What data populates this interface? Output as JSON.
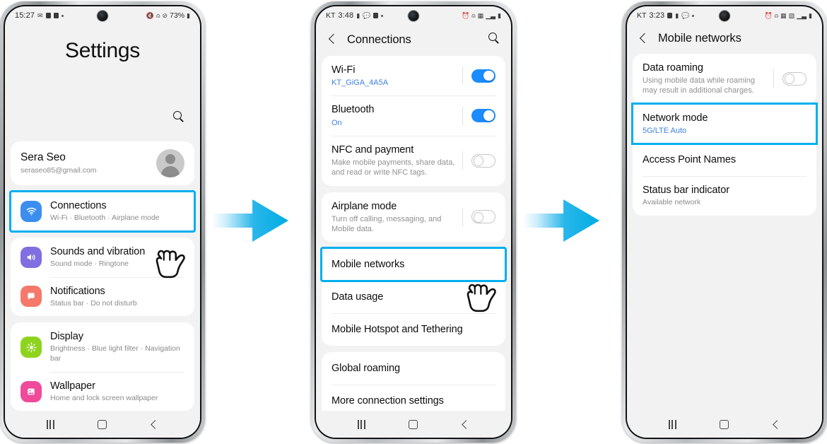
{
  "colors": {
    "accent_highlight": "#00AEEF",
    "toggle_on": "#1a8cff",
    "link_blue": "#3b7fe0",
    "screen_bg": "#f2f2f2",
    "card_bg": "#ffffff"
  },
  "phone1": {
    "status": {
      "time": "15:27",
      "icons_left": [
        "message-icon",
        "photo-icon",
        "mail-icon",
        "dot-icon"
      ],
      "icons_right": [
        "mute-icon",
        "wifi-icon",
        "do-not-disturb-icon"
      ],
      "battery_percent": "73%",
      "battery_icon": "battery-icon"
    },
    "title": "Settings",
    "search_icon": "search-icon",
    "account": {
      "name": "Sera Seo",
      "email": "seraseo85@gmail.com",
      "avatar": "avatar-icon"
    },
    "items": [
      {
        "title": "Connections",
        "subtitle": "Wi-Fi  ·  Bluetooth  ·  Airplane mode",
        "icon": "wifi-icon",
        "icon_color": "#3b8ef0",
        "highlighted": true
      },
      {
        "title": "Sounds and vibration",
        "subtitle": "Sound mode  ·  Ringtone",
        "icon": "speaker-icon",
        "icon_color": "#7f6fe0",
        "highlighted": false
      },
      {
        "title": "Notifications",
        "subtitle": "Status bar  ·  Do not disturb",
        "icon": "bell-icon",
        "icon_color": "#f4796b",
        "highlighted": false
      },
      {
        "title": "Display",
        "subtitle": "Brightness  ·  Blue light filter  ·  Navigation bar",
        "icon": "brightness-icon",
        "icon_color": "#8ed41f",
        "highlighted": false
      },
      {
        "title": "Wallpaper",
        "subtitle": "Home and lock screen wallpaper",
        "icon": "image-icon",
        "icon_color": "#ef4b9a",
        "highlighted": false
      }
    ],
    "navbar": [
      "recents-icon",
      "home-icon",
      "back-icon"
    ]
  },
  "phone2": {
    "status": {
      "carrier": "KT",
      "time": "3:48",
      "icons_left": [
        "battery-icon",
        "chat-icon",
        "video-icon",
        "dot-icon"
      ],
      "icons_right": [
        "alarm-icon",
        "wifi-icon",
        "network-icon",
        "signal-icon",
        "battery-icon"
      ]
    },
    "header": {
      "back_icon": "back-icon",
      "title": "Connections",
      "search_icon": "search-icon"
    },
    "items": [
      {
        "title": "Wi-Fi",
        "subtitle": "KT_GiGA_4A5A",
        "subtitle_style": "link",
        "toggle": "on"
      },
      {
        "title": "Bluetooth",
        "subtitle": "On",
        "subtitle_style": "link",
        "toggle": "on"
      },
      {
        "title": "NFC and payment",
        "subtitle": "Make mobile payments, share data, and read or write NFC tags.",
        "subtitle_style": "muted",
        "toggle": "off"
      },
      {
        "title": "Airplane mode",
        "subtitle": "Turn off calling, messaging, and Mobile data.",
        "subtitle_style": "muted",
        "toggle": "off"
      },
      {
        "title": "Mobile networks",
        "subtitle": "",
        "highlighted": true
      },
      {
        "title": "Data usage",
        "subtitle": ""
      },
      {
        "title": "Mobile Hotspot and Tethering",
        "subtitle": ""
      },
      {
        "title": "Global roaming",
        "subtitle": ""
      },
      {
        "title": "More connection settings",
        "subtitle": ""
      }
    ],
    "navbar": [
      "recents-icon",
      "home-icon",
      "back-icon"
    ]
  },
  "phone3": {
    "status": {
      "carrier": "KT",
      "time": "3:23",
      "icons_left": [
        "photo-icon",
        "battery-icon",
        "chat-icon",
        "dot-icon"
      ],
      "icons_right": [
        "alarm-icon",
        "wifi-icon",
        "network-icon",
        "lte-icon",
        "signal-icon",
        "battery-icon"
      ]
    },
    "header": {
      "back_icon": "back-icon",
      "title": "Mobile networks"
    },
    "items": [
      {
        "title": "Data roaming",
        "subtitle": "Using mobile data while roaming may result in additional charges.",
        "subtitle_style": "muted",
        "toggle": "off"
      },
      {
        "title": "Network mode",
        "subtitle": "5G/LTE Auto",
        "subtitle_style": "link",
        "highlighted": true
      },
      {
        "title": "Access Point Names",
        "subtitle": ""
      },
      {
        "title": "Status bar indicator",
        "subtitle": "Available network",
        "subtitle_style": "muted"
      }
    ],
    "navbar": [
      "recents-icon",
      "home-icon",
      "back-icon"
    ]
  },
  "arrows": [
    {
      "name": "flow-arrow-1",
      "direction": "right"
    },
    {
      "name": "flow-arrow-2",
      "direction": "right"
    }
  ],
  "cursors": [
    {
      "name": "tap-cursor-connections"
    },
    {
      "name": "tap-cursor-mobile-networks"
    }
  ]
}
